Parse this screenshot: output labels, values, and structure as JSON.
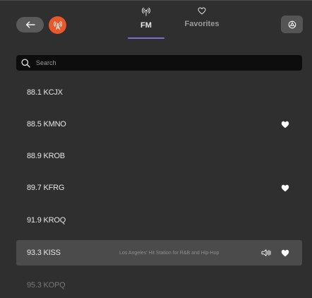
{
  "header": {
    "tabs": [
      {
        "label": "FM",
        "active": true
      },
      {
        "label": "Favorites",
        "active": false
      }
    ],
    "colors": {
      "accent": "#7b6fd6",
      "source_icon_bg": "#e8582a"
    }
  },
  "search": {
    "placeholder": "Search",
    "value": ""
  },
  "stations": [
    {
      "name": "88.1 KCJX",
      "favorite": false
    },
    {
      "name": "88.5 KMNO",
      "favorite": true
    },
    {
      "name": "88.9 KROB",
      "favorite": false
    },
    {
      "name": "89.7 KFRG",
      "favorite": true
    },
    {
      "name": "91.9 KROQ",
      "favorite": false
    },
    {
      "name": "93.3 KISS",
      "favorite": true,
      "selected": true,
      "description": "Los Angeles' Hit Station for R&B and Hip-Hop"
    },
    {
      "name": "95.3 KOPQ",
      "favorite": false
    }
  ]
}
